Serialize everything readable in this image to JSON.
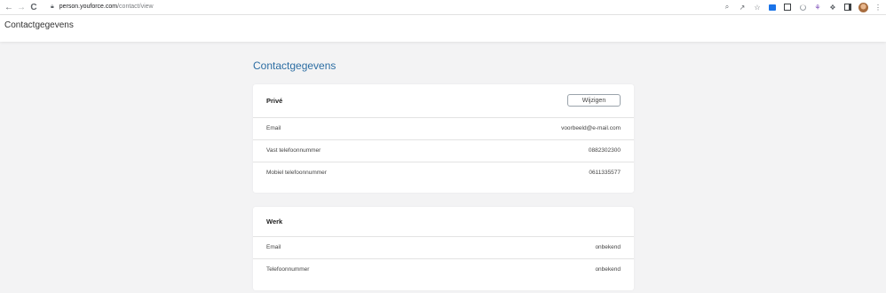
{
  "browser": {
    "url_host": "person.youforce.com",
    "url_path": "/contact/view",
    "back_icon": "←",
    "forward_icon": "→",
    "reload_icon": "C",
    "extensions": [
      "zoom-icon",
      "share-icon",
      "bookmark-star-icon",
      "ext-blue-icon",
      "ext-reader-icon",
      "ext-ring-icon",
      "ext-rose-icon",
      "puzzle-icon",
      "sidepanel-icon",
      "profile-avatar",
      "more-icon"
    ]
  },
  "header": {
    "title": "Contactgegevens"
  },
  "main": {
    "title": "Contactgegevens",
    "prive": {
      "heading": "Privé",
      "edit_label": "Wijzigen",
      "rows": [
        {
          "label": "Email",
          "value": "voorbeeld@e-mail.com"
        },
        {
          "label": "Vast telefoonnummer",
          "value": "0882302300"
        },
        {
          "label": "Mobiel telefoonnummer",
          "value": "0611335577"
        }
      ]
    },
    "werk": {
      "heading": "Werk",
      "rows": [
        {
          "label": "Email",
          "value": "onbekend"
        },
        {
          "label": "Telefoonnummer",
          "value": "onbekend"
        }
      ]
    }
  },
  "colors": {
    "accent_title": "#2d6ea3",
    "background": "#f3f3f4"
  }
}
